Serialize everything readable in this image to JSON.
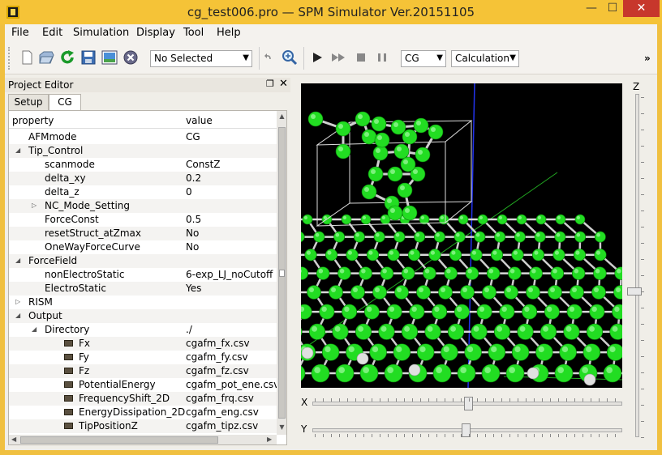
{
  "window": {
    "title": "cg_test006.pro — SPM Simulator Ver.20151105",
    "minimize": "—",
    "maximize": "☐",
    "close": "✕"
  },
  "menu": [
    "File",
    "Edit",
    "Simulation",
    "Display",
    "Tool",
    "Help"
  ],
  "toolbar": {
    "selection_combo": "No Selected",
    "method_combo": "CG",
    "mode_combo": "Calculation",
    "overflow": "»",
    "icons": [
      "new-file-icon",
      "open-folder-icon",
      "reload-icon",
      "save-icon",
      "image-icon",
      "stop-circle-icon",
      "undo-icon",
      "zoom-icon",
      "play-icon",
      "fast-forward-icon",
      "stop-icon",
      "pause-icon"
    ]
  },
  "project_editor": {
    "title": "Project Editor",
    "tabs": [
      "Setup",
      "CG"
    ],
    "active_tab": "CG",
    "columns": [
      "property",
      "value"
    ],
    "rows": [
      {
        "property": "AFMmode",
        "value": "CG"
      },
      {
        "property": "Tip_Control",
        "value": ""
      },
      {
        "property": "scanmode",
        "value": "ConstZ"
      },
      {
        "property": "delta_xy",
        "value": "0.2"
      },
      {
        "property": "delta_z",
        "value": "0"
      },
      {
        "property": "NC_Mode_Setting",
        "value": ""
      },
      {
        "property": "ForceConst",
        "value": "0.5"
      },
      {
        "property": "resetStruct_atZmax",
        "value": "No"
      },
      {
        "property": "OneWayForceCurve",
        "value": "No"
      },
      {
        "property": "ForceField",
        "value": ""
      },
      {
        "property": "nonElectroStatic",
        "value": "6-exp_LJ_noCutoff"
      },
      {
        "property": "ElectroStatic",
        "value": "Yes"
      },
      {
        "property": "RISM",
        "value": ""
      },
      {
        "property": "Output",
        "value": ""
      },
      {
        "property": "Directory",
        "value": "./"
      },
      {
        "property": "Fx",
        "value": "cgafm_fx.csv"
      },
      {
        "property": "Fy",
        "value": "cgafm_fy.csv"
      },
      {
        "property": "Fz",
        "value": "cgafm_fz.csv"
      },
      {
        "property": "PotentialEnergy",
        "value": "cgafm_pot_ene.csv"
      },
      {
        "property": "FrequencyShift_2D",
        "value": "cgafm_frq.csv"
      },
      {
        "property": "EnergyDissipation_2D",
        "value": "cgafm_eng.csv"
      },
      {
        "property": "TipPositionZ",
        "value": "cgafm_tipz.csv"
      }
    ]
  },
  "view": {
    "z_label": "Z",
    "x_label": "X",
    "y_label": "Y",
    "z_level": 0.56,
    "x_level": 0.5,
    "y_level": 0.5,
    "colors": {
      "carbon": "#22dd22",
      "hydrogen": "#e0e0e0",
      "axis_y": "#2233ee",
      "axis_x": "#22aa22",
      "background": "#000000"
    }
  }
}
